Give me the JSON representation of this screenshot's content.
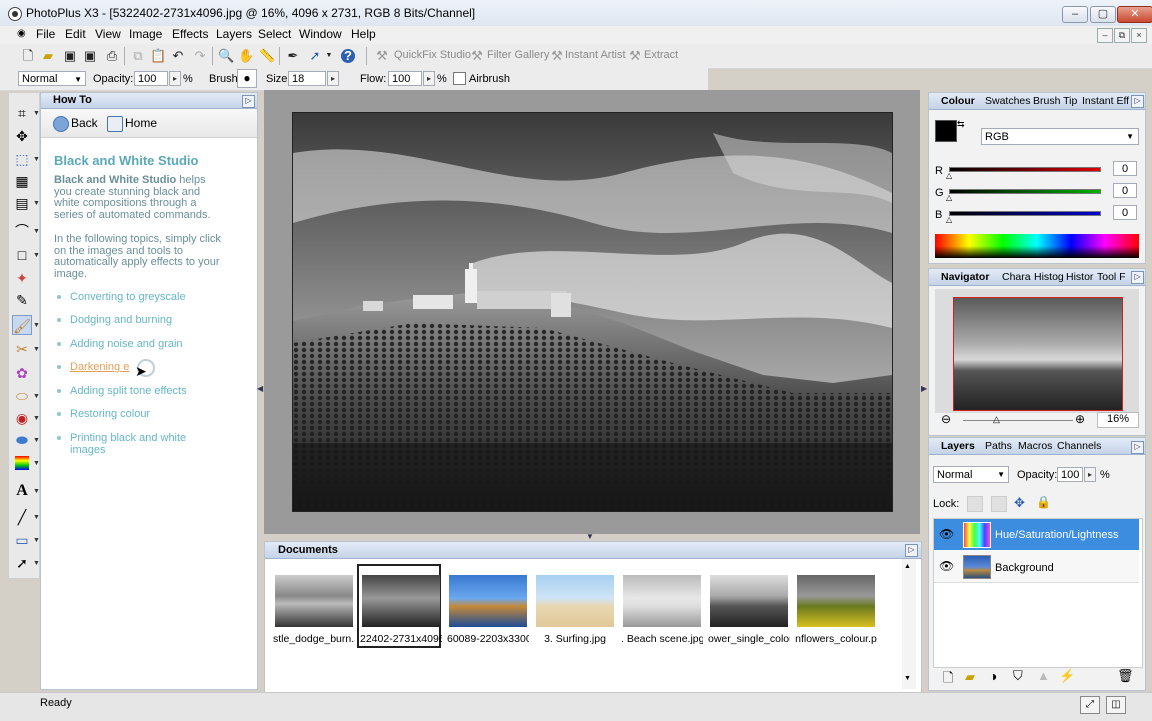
{
  "window": {
    "title": "PhotoPlus X3 - [5322402-2731x4096.jpg @ 16%, 4096 x 2731, RGB 8 Bits/Channel]",
    "min": "–",
    "max": "▢",
    "close": "✕"
  },
  "menu": [
    "File",
    "Edit",
    "View",
    "Image",
    "Effects",
    "Layers",
    "Select",
    "Window",
    "Help"
  ],
  "toolbar": {
    "quickfix": "QuickFix Studio",
    "filter": "Filter Gallery",
    "instant": "Instant Artist",
    "extract": "Extract",
    "help_icon": "?"
  },
  "context": {
    "blend_mode": "Normal",
    "opacity_label": "Opacity:",
    "opacity": "100",
    "pct": "%",
    "brush_label": "Brush:",
    "size_label": "Size:",
    "size": "18",
    "flow_label": "Flow:",
    "flow": "100",
    "airbrush": "Airbrush"
  },
  "howto": {
    "tab": "How To",
    "back": "Back",
    "home": "Home",
    "heading": "Black and White Studio",
    "para1_bold": "Black and White Studio",
    "para1_rest": " helps you create stunning black and white compositions through a series of automated commands.",
    "para2": "In the following topics, simply click on the images and tools to automatically apply effects to your image.",
    "links": [
      "Converting to greyscale",
      "Dodging and burning",
      "Adding noise and grain",
      "Darkening e",
      "Adding split tone effects",
      "Restoring colour",
      "Printing black and white images"
    ]
  },
  "documents": {
    "tab": "Documents",
    "files": [
      "stle_dodge_burn.S",
      "22402-2731x4096.",
      "60089-2203x3300.",
      "3. Surfing.jpg",
      ". Beach scene.jpg",
      "ower_single_colou",
      "nflowers_colour.p"
    ]
  },
  "colour_panel": {
    "tabs": [
      "Colour",
      "Swatches",
      "Brush Tip",
      "Instant Eff"
    ],
    "mode": "RGB",
    "channels": [
      {
        "label": "R",
        "value": "0",
        "color": "#e00000"
      },
      {
        "label": "G",
        "value": "0",
        "color": "#00b000"
      },
      {
        "label": "B",
        "value": "0",
        "color": "#0000d0"
      }
    ]
  },
  "navigator_panel": {
    "tabs": [
      "Navigator",
      "Chara",
      "Histog",
      "Histor",
      "Tool F"
    ],
    "zoom": "16%"
  },
  "layers_panel": {
    "tabs": [
      "Layers",
      "Paths",
      "Macros",
      "Channels"
    ],
    "blend_mode": "Normal",
    "opacity_label": "Opacity:",
    "opacity": "100",
    "pct": "%",
    "lock_label": "Lock:",
    "layers": [
      "Hue/Saturation/Lightness",
      "Background"
    ]
  },
  "status": "Ready"
}
